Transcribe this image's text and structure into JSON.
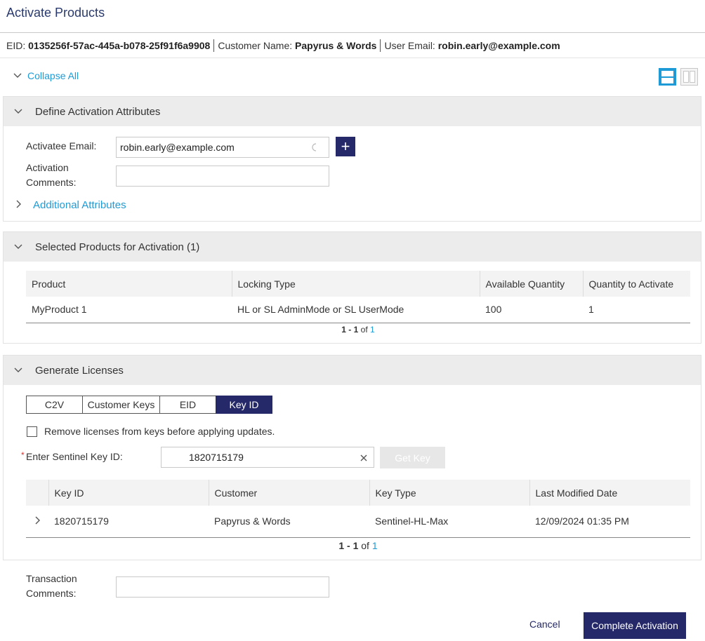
{
  "page": {
    "title": "Activate Products"
  },
  "info": {
    "eid_label": "EID:",
    "eid_value": "0135256f-57ac-445a-b078-25f91f6a9908",
    "customer_label": "Customer Name:",
    "customer_value": "Papyrus & Words",
    "email_label": "User Email:",
    "email_value": "robin.early@example.com"
  },
  "toolbar": {
    "collapse_all": "Collapse All"
  },
  "attributes": {
    "title": "Define Activation Attributes",
    "activatee_email_label": "Activatee Email:",
    "activatee_email_value": "robin.early@example.com",
    "comments_label_1": "Activation",
    "comments_label_2": "Comments:",
    "comments_value": "",
    "add_symbol": "+",
    "additional_attributes": "Additional Attributes"
  },
  "selected_products": {
    "title": "Selected Products for Activation (1)",
    "columns": [
      "Product",
      "Locking Type",
      "Available Quantity",
      "Quantity to Activate"
    ],
    "rows": [
      [
        "MyProduct 1",
        "HL or SL AdminMode or SL UserMode",
        "100",
        "1"
      ]
    ],
    "pager": {
      "range": "1 - 1",
      "of": "of",
      "total": "1"
    }
  },
  "generate": {
    "title": "Generate Licenses",
    "tabs": [
      "C2V",
      "Customer Keys",
      "EID",
      "Key ID"
    ],
    "active_tab": "Key ID",
    "remove_licenses_label": "Remove licenses from keys before applying updates.",
    "required_mark": "*",
    "key_id_label": "Enter Sentinel Key ID:",
    "key_id_value": "1820715179",
    "get_key": "Get Key",
    "columns": [
      "Key ID",
      "Customer",
      "Key Type",
      "Last Modified Date"
    ],
    "rows": [
      [
        "1820715179",
        "Papyrus & Words",
        "Sentinel-HL-Max",
        "12/09/2024 01:35 PM"
      ]
    ],
    "pager": {
      "range": "1 - 1",
      "of": "of",
      "total": "1"
    }
  },
  "transaction": {
    "label_1": "Transaction",
    "label_2": "Comments:",
    "value": ""
  },
  "footer": {
    "cancel": "Cancel",
    "complete": "Complete Activation"
  },
  "colors": {
    "accent": "#1e9bd7",
    "primary": "#25296a"
  }
}
